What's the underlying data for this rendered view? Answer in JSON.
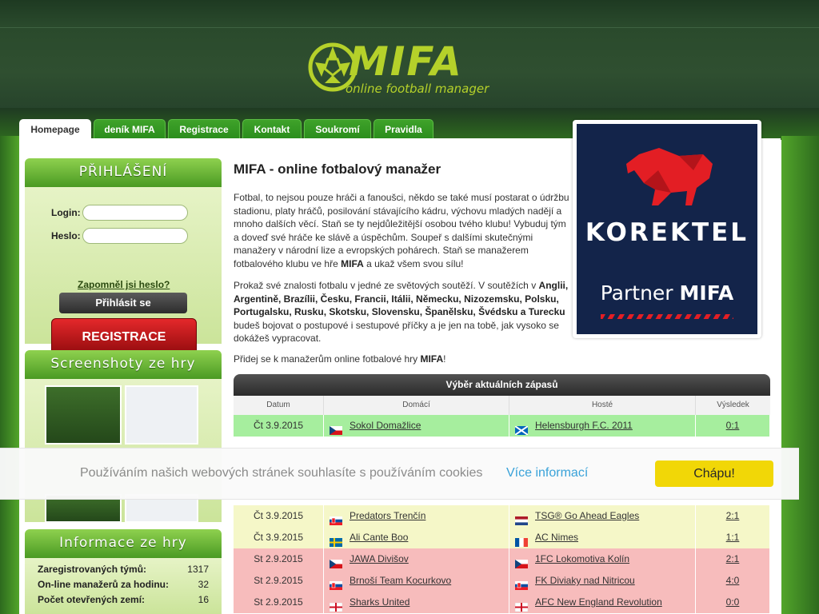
{
  "brand": {
    "name": "MIFA",
    "tagline": "online football manager"
  },
  "tabs": [
    "Homepage",
    "deník MIFA",
    "Registrace",
    "Kontakt",
    "Soukromí",
    "Pravidla"
  ],
  "login": {
    "title": "PŘIHLÁŠENÍ",
    "login_label": "Login:",
    "password_label": "Heslo:",
    "forgot": "Zapomněl jsi heslo?",
    "submit": "Přihlásit se",
    "register": "REGISTRACE"
  },
  "screenshots": {
    "title": "Screenshoty ze hry"
  },
  "info": {
    "title": "Informace ze hry",
    "rows": [
      {
        "label": "Zaregistrovaných týmů:",
        "value": "1317"
      },
      {
        "label": "On-line manažerů za hodinu:",
        "value": "32"
      },
      {
        "label": "Počet otevřených zemí:",
        "value": "16"
      }
    ]
  },
  "content": {
    "title": "MIFA - online fotbalový manažer",
    "p1": "Fotbal, to nejsou pouze hráči a fanoušci, někdo se také musí postarat o údržbu stadionu, platy hráčů, posilování stávajícího kádru, výchovu mladých nadějí a mnoho dalších věcí. Staň se ty nejdůležitější osobou tvého klubu! Vybuduj tým a doveď své hráče ke slávě a úspěchům. Soupeř s dalšími skutečnými manažery v národní lize a evropských pohárech. Staň se manažerem fotbalového klubu ve hře",
    "p1_bold": "MIFA",
    "p1_end": "a ukaž všem svou sílu!",
    "p2_start": "Prokaž své znalosti fotbalu v jedné ze světových soutěží. V soutěžích v",
    "p2_countries": "Anglii, Argentině, Brazílii, Česku, Francii, Itálii, Německu, Nizozemsku, Polsku, Portugalsku, Rusku, Skotsku, Slovensku, Španělsku, Švédsku a Turecku",
    "p2_end": "budeš bojovat o postupové i sestupové příčky a je jen na tobě, jak vysoko se dokážeš vypracovat.",
    "p3_start": "Přidej se k manažerům online fotbalové hry",
    "p3_bold": "MIFA",
    "p3_end": "!"
  },
  "banner": {
    "brand": "KOREKTEL",
    "partner": "Partner",
    "partner_bold": "MIFA"
  },
  "matches": {
    "title": "Výběr aktuálních zápasů",
    "columns": [
      "Datum",
      "Domácí",
      "Hosté",
      "Výsledek"
    ],
    "rows": [
      {
        "date": "Čt 3.9.2015",
        "home": "Sokol Domažlice",
        "home_flag": "cz",
        "away": "Helensburgh F.C. 2011",
        "away_flag": "sco",
        "result": "0:1",
        "bg": "#a6ee9e"
      },
      {
        "date": "Čt 3.9.2015",
        "home": "Predators Trenčín",
        "home_flag": "sk",
        "away": "TSG® Go Ahead Eagles",
        "away_flag": "nl",
        "result": "2:1",
        "bg": "#f5f7c8"
      },
      {
        "date": "Čt 3.9.2015",
        "home": "Ali Cante Boo",
        "home_flag": "se",
        "away": "AC Nimes",
        "away_flag": "fr",
        "result": "1:1",
        "bg": "#f5f7c8"
      },
      {
        "date": "St 2.9.2015",
        "home": "JAWA Divišov",
        "home_flag": "cz",
        "away": "1FC Lokomotiva Kolín",
        "away_flag": "cz",
        "result": "2:1",
        "bg": "#f7bcbc"
      },
      {
        "date": "St 2.9.2015",
        "home": "Brnoší Team Kocurkovo",
        "home_flag": "sk",
        "away": "FK Diviaky nad Nitricou",
        "away_flag": "sk",
        "result": "4:0",
        "bg": "#f7bcbc"
      },
      {
        "date": "St 2.9.2015",
        "home": "Sharks United",
        "home_flag": "en",
        "away": "AFC New England Revolution",
        "away_flag": "en",
        "result": "0:0",
        "bg": "#f7bcbc"
      }
    ]
  },
  "cookie": {
    "text": "Používáním našich webových stránek souhlasíte s používáním cookies",
    "link": "Více informací",
    "button": "Chápu!"
  }
}
